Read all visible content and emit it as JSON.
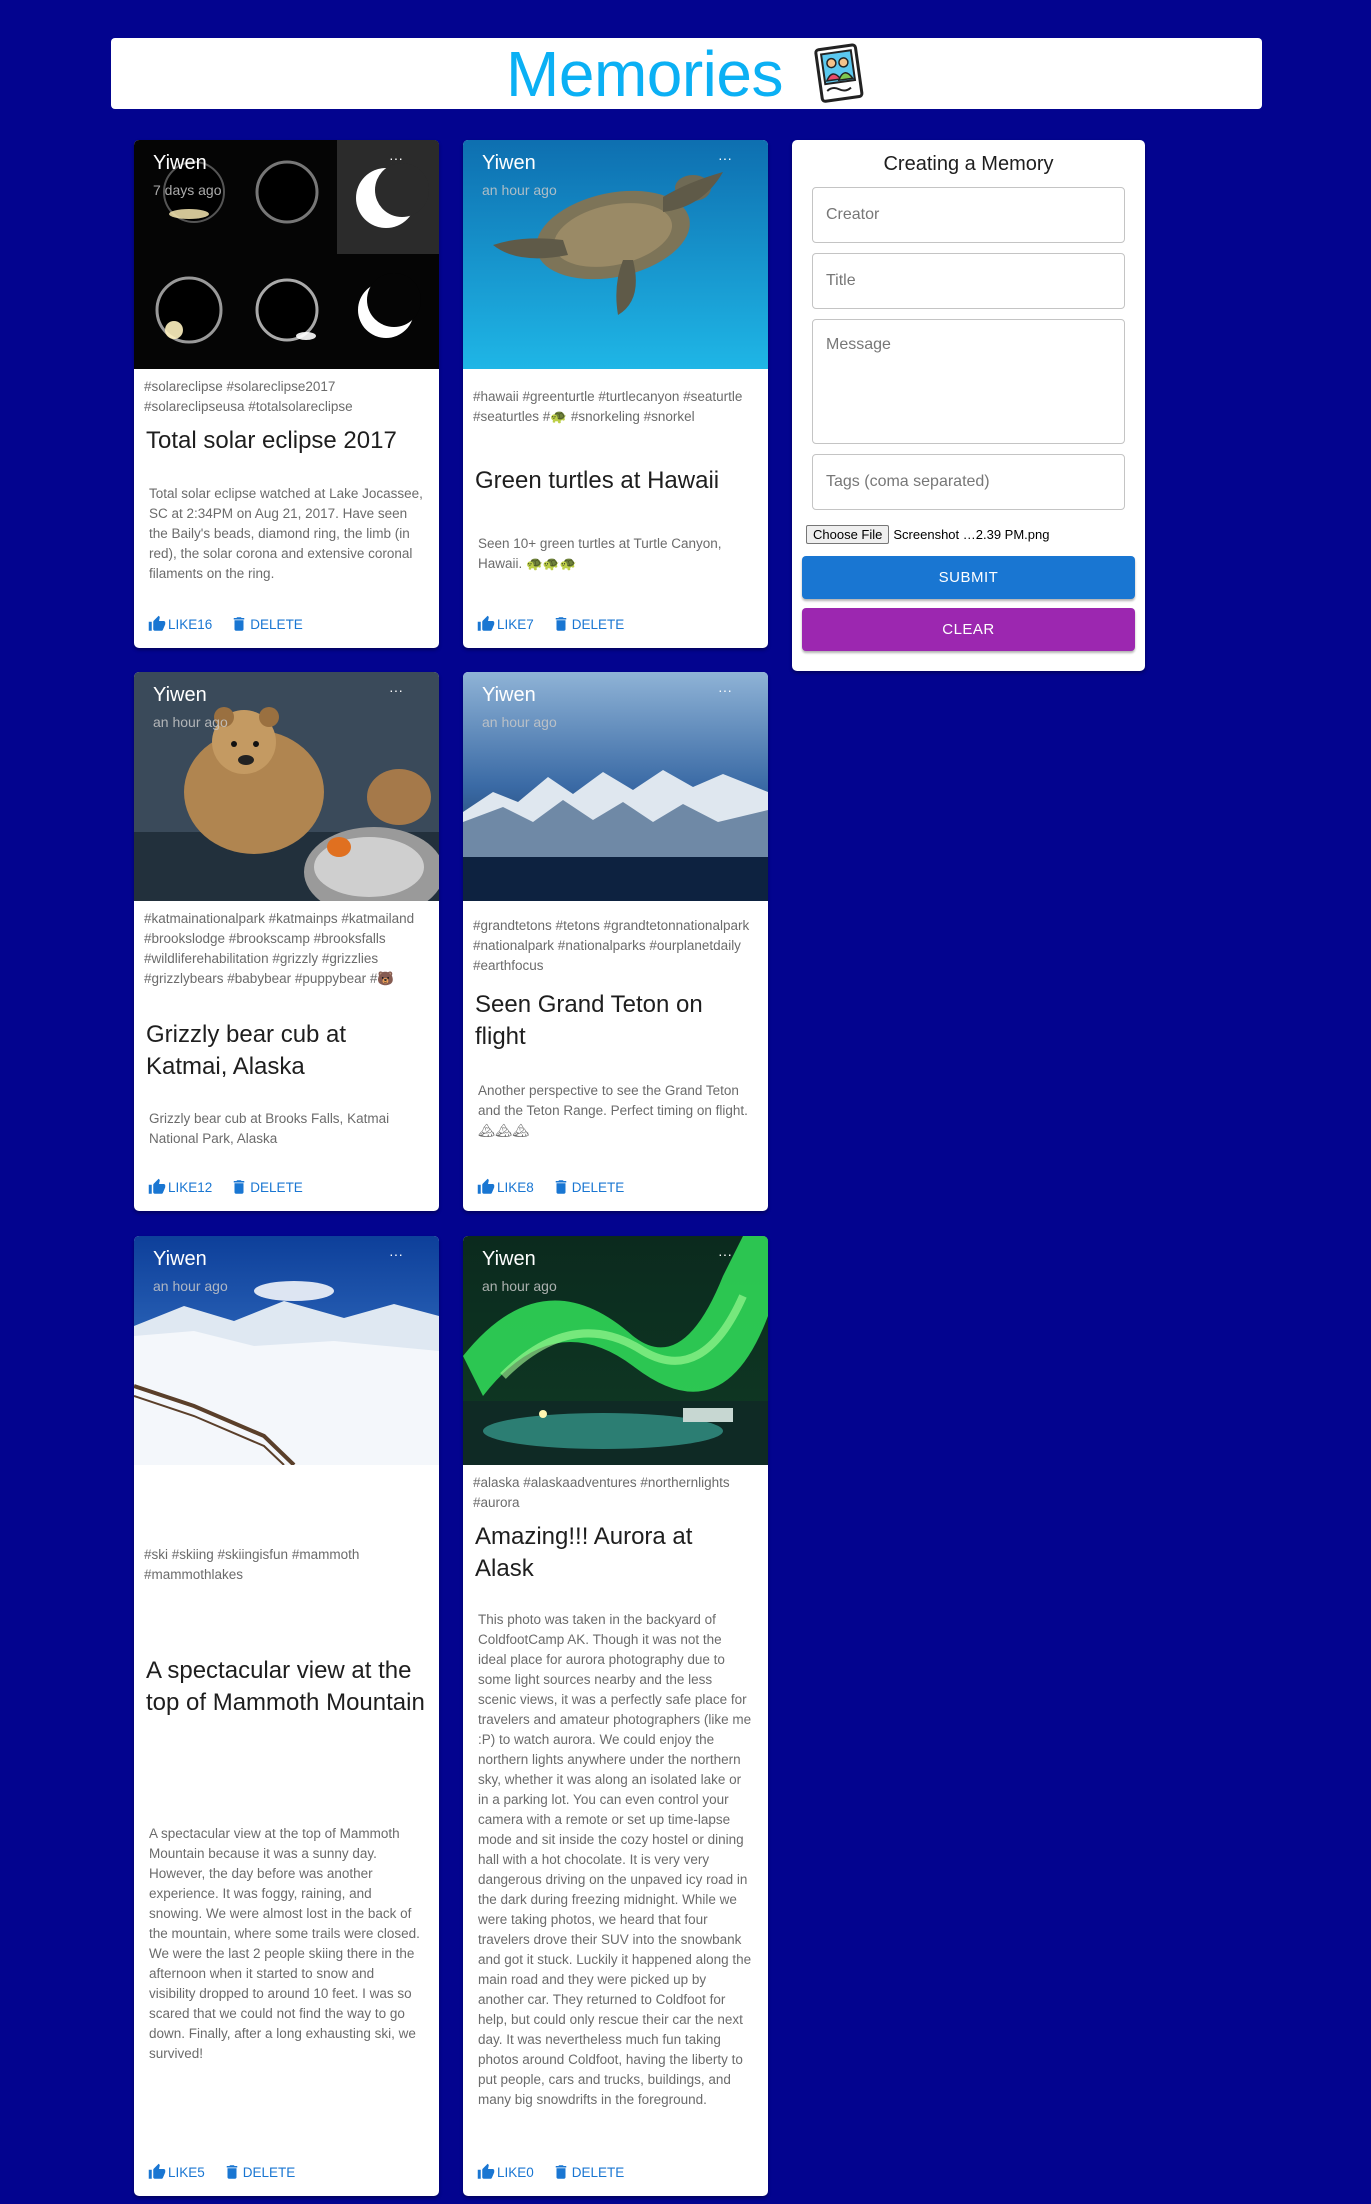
{
  "header": {
    "title": "Memories",
    "logo_icon": "photo-memories-icon"
  },
  "form": {
    "title": "Creating a Memory",
    "creator_placeholder": "Creator",
    "title_placeholder": "Title",
    "message_placeholder": "Message",
    "tags_placeholder": "Tags (coma separated)",
    "choose_file_label": "Choose File",
    "file_name": "Screenshot …2.39 PM.png",
    "submit_label": "SUBMIT",
    "clear_label": "CLEAR"
  },
  "colors": {
    "background": "#03048f",
    "title": "#0bb0f4",
    "primary": "#1976d2",
    "secondary": "#9c27b0"
  },
  "delete_label": "DELETE",
  "more_label": "···",
  "posts": [
    {
      "creator": "Yiwen",
      "time": "7 days ago",
      "tags": "#solareclipse #solareclipse2017 #solareclipseusa #totalsolareclipse",
      "title": "Total solar eclipse 2017",
      "message": "Total solar eclipse watched at Lake Jocassee, SC at 2:34PM on Aug 21, 2017. Have seen the Baily's beads, diamond ring, the limb (in red), the solar corona and extensive coronal filaments on the ring.",
      "like_label": "LIKE16"
    },
    {
      "creator": "Yiwen",
      "time": "an hour ago",
      "tags": "#hawaii #greenturtle #turtlecanyon #seaturtle #seaturtles #🐢 #snorkeling #snorkel",
      "title": "Green turtles at Hawaii",
      "message": "Seen 10+ green turtles at Turtle Canyon, Hawaii. 🐢🐢🐢",
      "like_label": "LIKE7"
    },
    {
      "creator": "Yiwen",
      "time": "an hour ago",
      "tags": "#katmainationalpark #katmainps #katmailand #brookslodge #brookscamp #brooksfalls #wildliferehabilitation #grizzly #grizzlies #grizzlybears #babybear #puppybear #🐻",
      "title": "Grizzly bear cub at Katmai, Alaska",
      "message": "Grizzly bear cub at Brooks Falls, Katmai National Park, Alaska",
      "like_label": "LIKE12"
    },
    {
      "creator": "Yiwen",
      "time": "an hour ago",
      "tags": "#grandtetons #tetons #grandtetonnationalpark #nationalpark #nationalparks #ourplanetdaily #earthfocus",
      "title": "Seen Grand Teton on flight",
      "message": "Another perspective to see the Grand Teton and the Teton Range. Perfect timing on flight. 🏔🏔🏔",
      "like_label": "LIKE8"
    },
    {
      "creator": "Yiwen",
      "time": "an hour ago",
      "tags": "#ski #skiing #skiingisfun #mammoth #mammothlakes",
      "title": "A spectacular view at the top of Mammoth Mountain",
      "message": "A spectacular view at the top of Mammoth Mountain because it was a sunny day. However, the day before was another experience. It was foggy, raining, and snowing. We were almost lost in the back of the mountain, where some trails were closed. We were the last 2 people skiing there in the afternoon when it started to snow and visibility dropped to around 10 feet. I was so scared that we could not find the way to go down. Finally, after a long exhausting ski, we survived!",
      "like_label": "LIKE5"
    },
    {
      "creator": "Yiwen",
      "time": "an hour ago",
      "tags": "#alaska #alaskaadventures #northernlights #aurora",
      "title": "Amazing!!! Aurora at Alask",
      "message": "This photo was taken in the backyard of ColdfootCamp AK. Though it was not the ideal place for aurora photography due to some light sources nearby and the less scenic views, it was a perfectly safe place for travelers and amateur photographers (like me :P) to watch aurora. We could enjoy the northern lights anywhere under the northern sky, whether it was along an isolated lake or in a parking lot. You can even control your camera with a remote or set up time-lapse mode and sit inside the cozy hostel or dining hall with a hot chocolate. It is very very dangerous driving on the unpaved icy road in the dark during freezing midnight. While we were taking photos, we heard that four travelers drove their SUV into the snowbank and got it stuck. Luckily it happened along the main road and they were picked up by another car. They returned to Coldfoot for help, but could only rescue their car the next day. It was nevertheless much fun taking photos around Coldfoot, having the liberty to put people, cars and trucks, buildings, and many big snowdrifts in the foreground.",
      "like_label": "LIKE0"
    }
  ]
}
